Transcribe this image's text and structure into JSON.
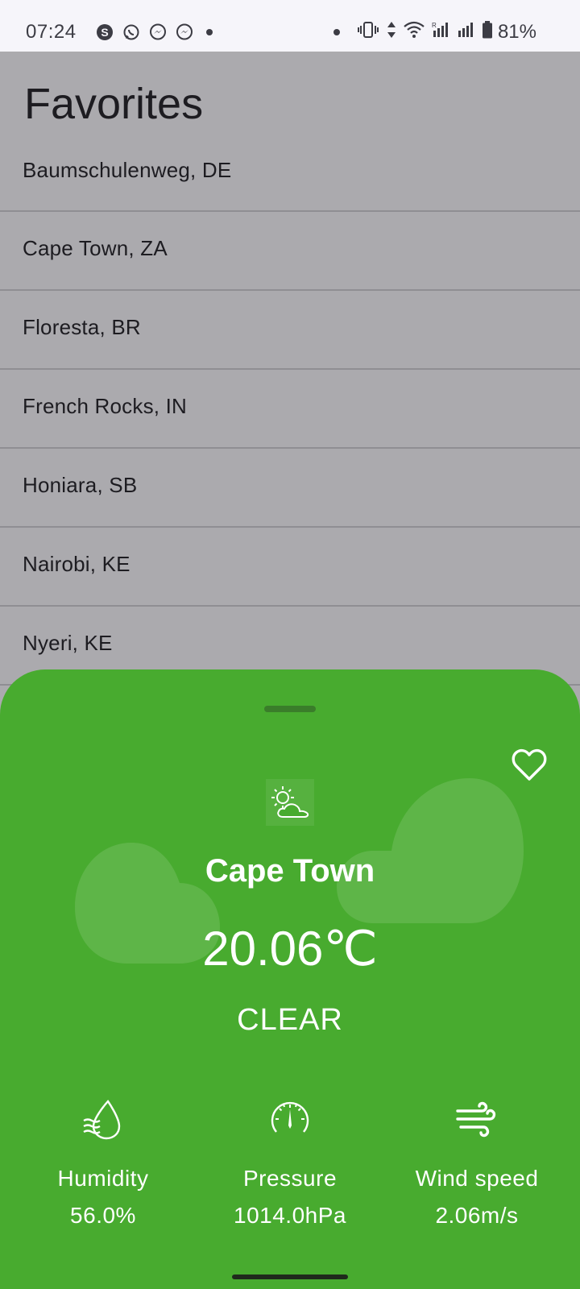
{
  "status_bar": {
    "time": "07:24",
    "notifications": [
      "skype-icon",
      "whatsapp-icon",
      "messenger-icon",
      "messenger-icon"
    ],
    "battery": "81%"
  },
  "screen": {
    "title": "Favorites"
  },
  "favorites": [
    {
      "label": "Baumschulenweg, DE"
    },
    {
      "label": "Cape Town, ZA"
    },
    {
      "label": "Floresta, BR"
    },
    {
      "label": "French Rocks, IN"
    },
    {
      "label": "Honiara, SB"
    },
    {
      "label": "Nairobi, KE"
    },
    {
      "label": "Nyeri, KE"
    }
  ],
  "sheet": {
    "city": "Cape Town",
    "temperature": "20.06℃",
    "condition": "CLEAR",
    "icon": "partly-cloudy-icon",
    "accent_color": "#48ab2f",
    "stats": {
      "humidity": {
        "label": "Humidity",
        "value": "56.0%"
      },
      "pressure": {
        "label": "Pressure",
        "value": "1014.0hPa"
      },
      "wind": {
        "label": "Wind speed",
        "value": "2.06m/s"
      }
    }
  }
}
